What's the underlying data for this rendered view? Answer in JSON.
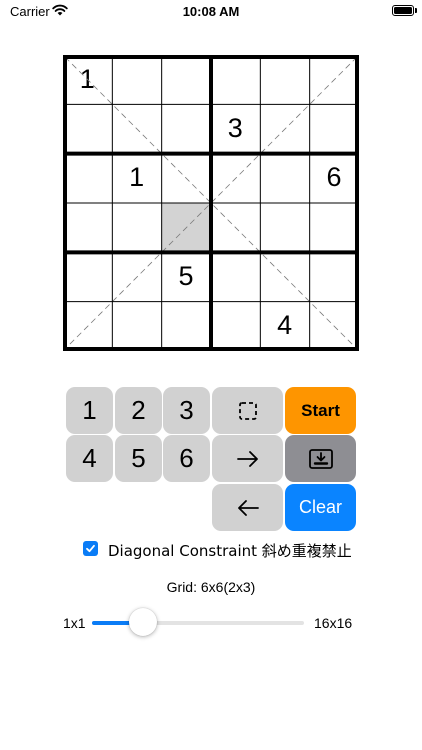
{
  "status_bar": {
    "carrier": "Carrier",
    "time": "10:08 AM"
  },
  "grid": {
    "size": 6,
    "box_rows": 2,
    "box_cols": 3,
    "selected": [
      3,
      2
    ],
    "cells": [
      [
        "1",
        "",
        "",
        "",
        "",
        ""
      ],
      [
        "",
        "",
        "",
        "3",
        "",
        ""
      ],
      [
        "",
        "1",
        "",
        "",
        "",
        "6"
      ],
      [
        "",
        "",
        "",
        "",
        "",
        ""
      ],
      [
        "",
        "",
        "5",
        "",
        "",
        ""
      ],
      [
        "",
        "",
        "",
        "",
        "4",
        ""
      ]
    ]
  },
  "keypad": {
    "digits": [
      "1",
      "2",
      "3",
      "4",
      "5",
      "6"
    ],
    "start_label": "Start",
    "clear_label": "Clear",
    "icons": {
      "select": "dashed-square-icon",
      "right": "arrow-right-icon",
      "left": "arrow-left-icon",
      "save": "tray-download-icon"
    },
    "colors": {
      "key": "#d1d1d1",
      "start": "#fe9500",
      "save": "#8e8e93",
      "clear": "#0a84ff"
    }
  },
  "diagonal": {
    "checked": true,
    "label": "Diagonal Constraint 斜め重複禁止"
  },
  "grid_size": {
    "label": "Grid: 6x6(2x3)",
    "min_label": "1x1",
    "max_label": "16x16",
    "slider_fraction": 0.24
  },
  "accent_color": "#0a7cf6"
}
